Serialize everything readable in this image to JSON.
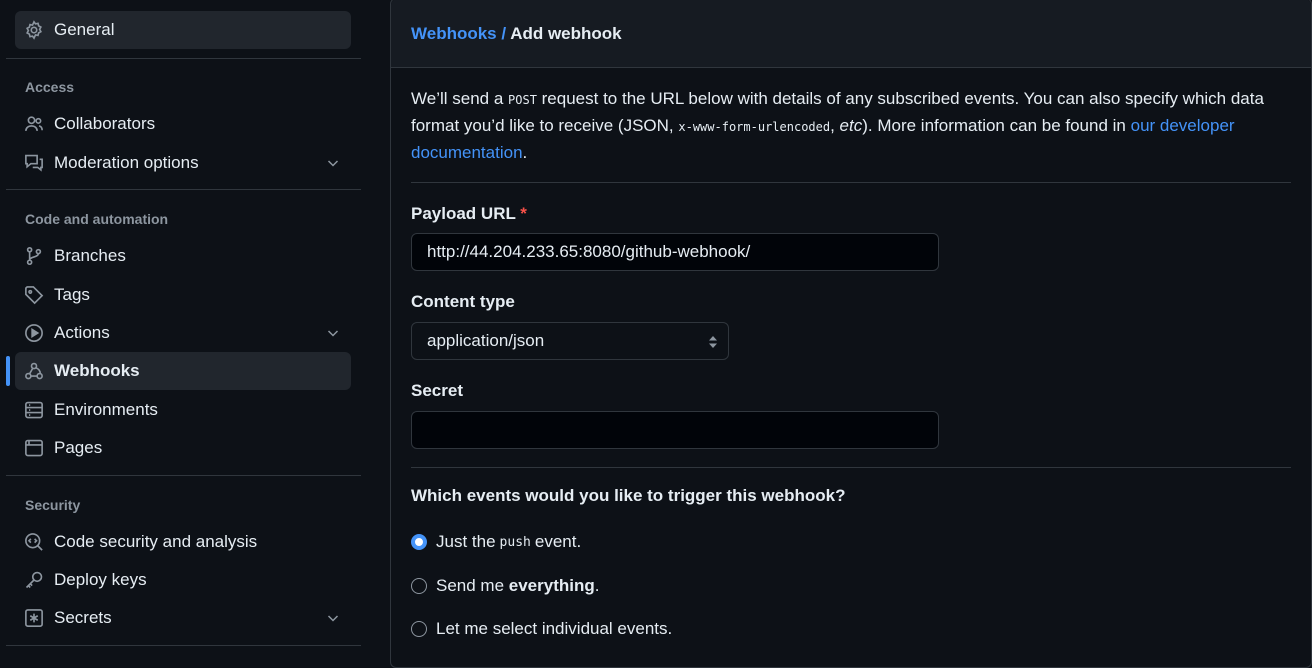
{
  "sidebar": {
    "general": "General",
    "access_title": "Access",
    "collaborators": "Collaborators",
    "moderation": "Moderation options",
    "code_title": "Code and automation",
    "branches": "Branches",
    "tags": "Tags",
    "actions": "Actions",
    "webhooks": "Webhooks",
    "environments": "Environments",
    "pages": "Pages",
    "security_title": "Security",
    "code_security": "Code security and analysis",
    "deploy_keys": "Deploy keys",
    "secrets": "Secrets",
    "active_item": "Webhooks"
  },
  "header": {
    "crumb_link": "Webhooks",
    "crumb_sep": " / ",
    "crumb_current": "Add webhook"
  },
  "intro": {
    "p1": "We’ll send a ",
    "post": "POST",
    "p2": " request to the URL below with details of any subscribed events. You can also specify which data format you’d like to receive (JSON, ",
    "form": "x-www-form-urlencoded",
    "p3": ", ",
    "etc": "etc",
    "p4": "). More information can be found in ",
    "link": "our developer documentation",
    "p5": "."
  },
  "form": {
    "payload_label": "Payload URL",
    "required_mark": "*",
    "payload_value": "http://44.204.233.65:8080/github-webhook/",
    "content_type_label": "Content type",
    "content_type_value": "application/json",
    "secret_label": "Secret",
    "secret_value": ""
  },
  "events": {
    "question": "Which events would you like to trigger this webhook?",
    "opt1_a": "Just the",
    "opt1_code": "push",
    "opt1_b": "event.",
    "opt2_a": "Send me ",
    "opt2_bold": "everything",
    "opt2_b": ".",
    "opt3": "Let me select individual events.",
    "selected": "Just the push event."
  },
  "colors": {
    "accent": "#4493f8",
    "background": "#0d1117",
    "required": "#f85149"
  }
}
